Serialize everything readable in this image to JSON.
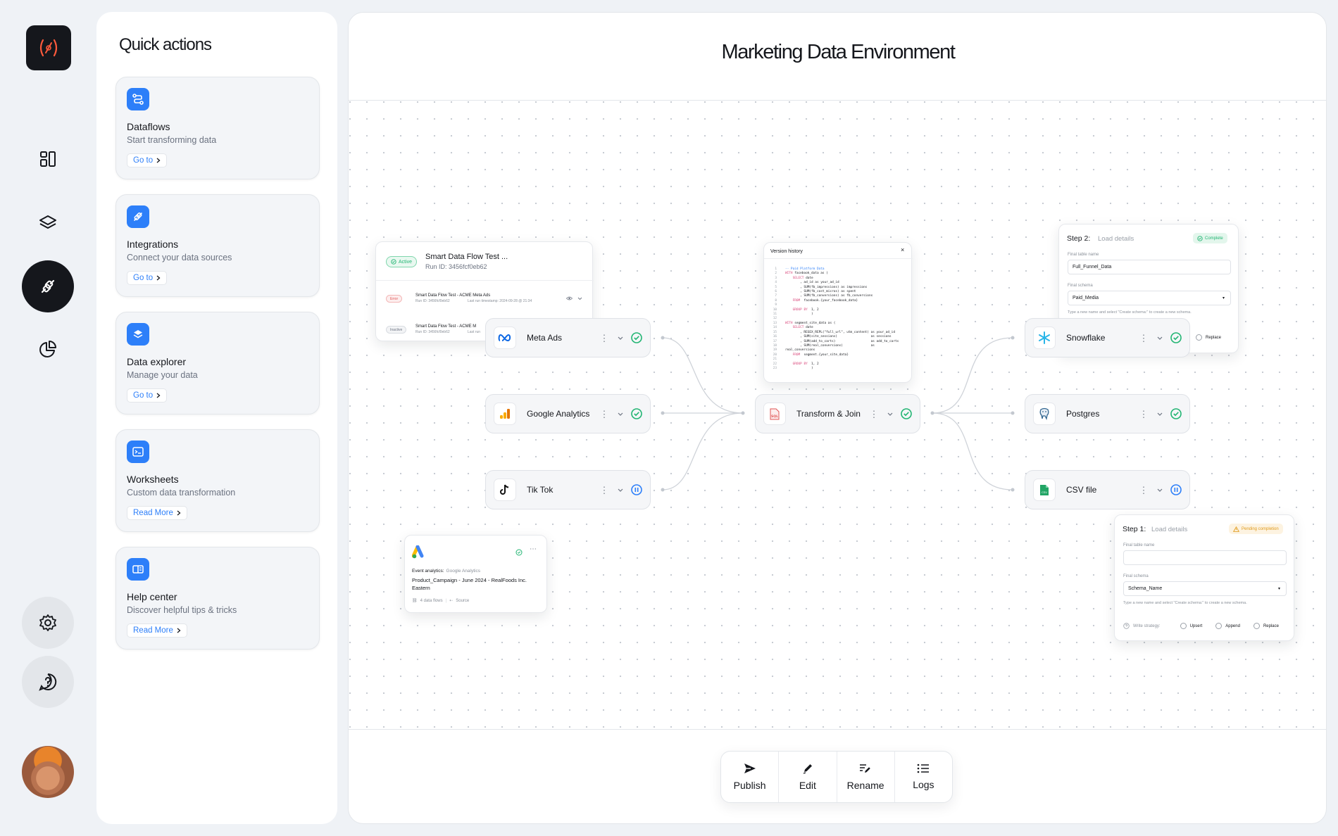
{
  "quick_actions": {
    "title": "Quick actions",
    "cards": [
      {
        "title": "Dataflows",
        "subtitle": "Start transforming data",
        "action": "Go to",
        "icon": "dataflow-icon"
      },
      {
        "title": "Integrations",
        "subtitle": "Connect your data sources",
        "action": "Go to",
        "icon": "plug-icon"
      },
      {
        "title": "Data explorer",
        "subtitle": "Manage your data",
        "action": "Go to",
        "icon": "layers-icon"
      },
      {
        "title": "Worksheets",
        "subtitle": "Custom data transformation",
        "action": "Read More",
        "icon": "terminal-icon"
      },
      {
        "title": "Help center",
        "subtitle": "Discover helpful tips & tricks",
        "action": "Read More",
        "icon": "book-icon"
      }
    ]
  },
  "main": {
    "title": "Marketing Data Environment",
    "nodes": {
      "sources": [
        {
          "name": "Meta Ads",
          "status": "complete"
        },
        {
          "name": "Google Analytics",
          "status": "complete"
        },
        {
          "name": "Tik Tok",
          "status": "paused"
        }
      ],
      "transform": {
        "name": "Transform & Join",
        "status": "complete"
      },
      "destinations": [
        {
          "name": "Snowflake",
          "status": "complete"
        },
        {
          "name": "Postgres",
          "status": "complete"
        },
        {
          "name": "CSV file",
          "status": "paused"
        }
      ]
    },
    "run_panel": {
      "badge": "Active",
      "title": "Smart Data Flow Test ...",
      "run_id": "Run ID: 3456fcf0eb62",
      "rows": [
        {
          "badge": "Error",
          "title": "Smart Data Flow Test - ACME Meta Ads",
          "run_id": "Run ID: 3456fcf0eb62",
          "last_run": "Last run timestamp: 2024-09-28 @ 21:34"
        },
        {
          "badge": "Inactive",
          "title": "Smart Data Flow Test - ACME M",
          "run_id": "Run ID: 3456fcf0eb62",
          "last_run": "Last run"
        }
      ]
    },
    "version_history": {
      "title": "Version history",
      "lines": [
        "-- Paid Platform Data",
        "WITH facebook_data as (",
        "    SELECT date",
        "        , ad_id as your_ad_id",
        "        , SUM(fb_impressions) as impressions",
        "        , SUM(fb_cost_micros) as spent",
        "        , SUM(fb_conversions) as fb_conversions",
        "    FROM  facebook.{your_facebook_data}",
        "",
        "    GROUP BY  1, 2",
        "              )",
        "",
        "WITH segment_site_data as (",
        "    SELECT date",
        "        , REGEX_REPL(\"full_url\", utm_content) as your_ad_id",
        "        , SUM(site_sessions)                  as sessions",
        "        , SUM(add_to_carts)                   as add_to_carts",
        "        , SUM(real_conversions)               as",
        "real_conversions",
        "    FROM  segment.{your_site_data}",
        "",
        "    GROUP BY  1, 2",
        "              )"
      ]
    },
    "step2": {
      "step": "Step 2:",
      "label": "Load details",
      "badge": "Complete",
      "table_label": "Final table name",
      "table_value": "Full_Funnel_Data",
      "schema_label": "Final schema",
      "schema_value": "Paid_Media",
      "hint": "Type a new name and select \"Create schema:\" to create a new schema.",
      "replace": "Replace"
    },
    "step1": {
      "step": "Step 1:",
      "label": "Load details",
      "badge": "Pending completion",
      "table_label": "Final table name",
      "table_value": "",
      "schema_label": "Final schema",
      "schema_value": "Schema_Name",
      "hint": "Type a new name and select \"Create schema:\" to create a new schema.",
      "write_label": "Write strategy:",
      "options": [
        "Upsert",
        "Append",
        "Replace"
      ]
    },
    "event_card": {
      "label": "Event analytics:",
      "source": "Google Analytics",
      "name": "Product_Campaign - June 2024 - RealFoods Inc. Eastern",
      "flows": "4 data flows",
      "type": "Source"
    }
  },
  "bottom_bar": [
    {
      "label": "Publish",
      "icon": "send-icon"
    },
    {
      "label": "Edit",
      "icon": "pencil-icon"
    },
    {
      "label": "Rename",
      "icon": "rename-icon"
    },
    {
      "label": "Logs",
      "icon": "list-icon"
    }
  ],
  "colors": {
    "accent": "#2d7ff9",
    "success": "#22b573",
    "dark": "#15171c",
    "logo": "#ff5a3c"
  }
}
